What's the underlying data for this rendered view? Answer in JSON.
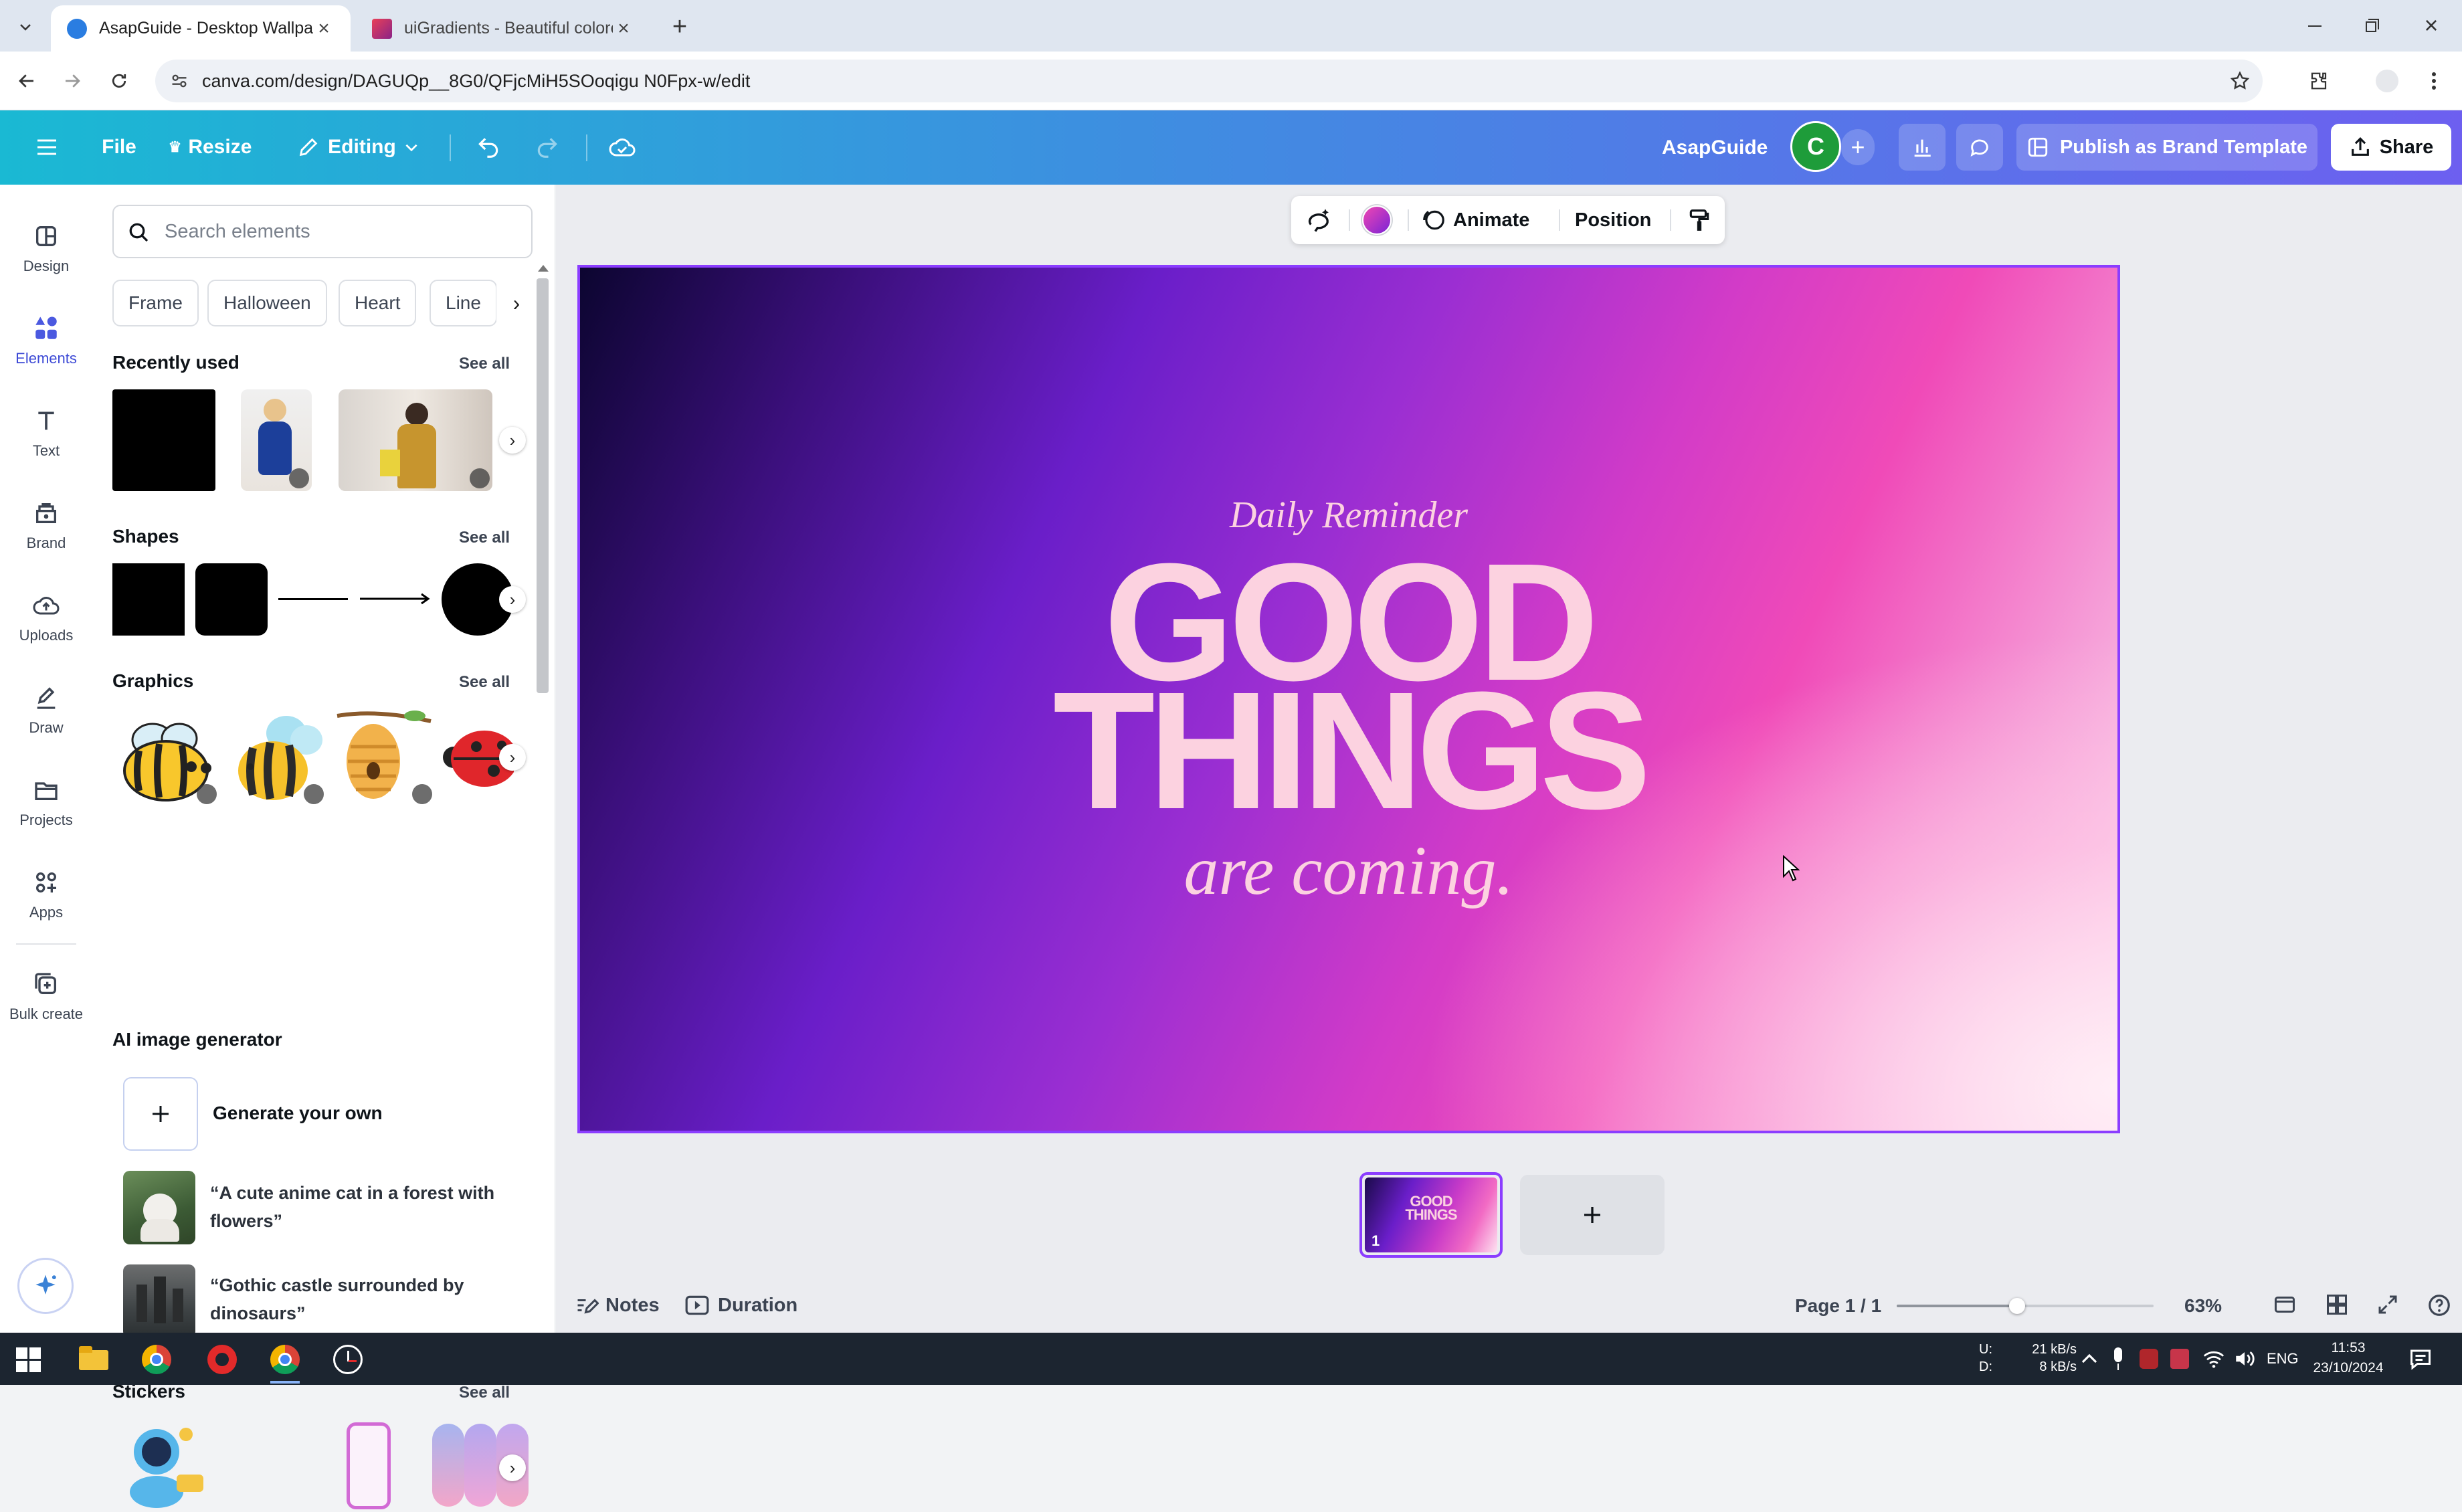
{
  "browser": {
    "tabs": [
      {
        "title": "AsapGuide - Desktop Wallpape",
        "active": true
      },
      {
        "title": "uiGradients - Beautiful colored",
        "active": false
      }
    ],
    "url": "canva.com/design/DAGUQp__8G0/QFjcMiH5SOoqigu N0Fpx-w/edit"
  },
  "topbar": {
    "file_label": "File",
    "resize_label": "Resize",
    "editing_label": "Editing",
    "team_name": "AsapGuide",
    "avatar_letter": "C",
    "publish_label": "Publish as Brand Template",
    "share_label": "Share"
  },
  "rail": [
    {
      "label": "Design",
      "icon": "design-icon"
    },
    {
      "label": "Elements",
      "icon": "elements-icon",
      "active": true
    },
    {
      "label": "Text",
      "icon": "text-icon"
    },
    {
      "label": "Brand",
      "icon": "brand-icon"
    },
    {
      "label": "Uploads",
      "icon": "uploads-icon"
    },
    {
      "label": "Draw",
      "icon": "draw-icon"
    },
    {
      "label": "Projects",
      "icon": "projects-icon"
    },
    {
      "label": "Apps",
      "icon": "apps-icon"
    },
    {
      "label": "Bulk create",
      "icon": "bulk-create-icon"
    }
  ],
  "panel": {
    "search_placeholder": "Search elements",
    "chips": [
      "Frame",
      "Halloween",
      "Heart",
      "Line"
    ],
    "recently_used_title": "Recently used",
    "shapes_title": "Shapes",
    "graphics_title": "Graphics",
    "ai_title": "AI image generator",
    "stickers_title": "Stickers",
    "see_all": "See all",
    "generate_label": "Generate your own",
    "prompt1": "“A cute anime cat in a forest with flowers”",
    "prompt2": "“Gothic castle surrounded by dinosaurs”"
  },
  "toolbar": {
    "animate_label": "Animate",
    "position_label": "Position"
  },
  "design": {
    "subtitle": "Daily Reminder",
    "line1": "GOOD",
    "line2": "THINGS",
    "tagline": "are coming."
  },
  "pages": {
    "thumb_line1": "GOOD",
    "thumb_line2": "THINGS",
    "page_number": "1"
  },
  "bottombar": {
    "notes_label": "Notes",
    "duration_label": "Duration",
    "page_indicator": "Page 1 / 1",
    "zoom": "63%",
    "zoom_fraction": 0.47
  },
  "taskbar": {
    "net_up": "21 kB/s",
    "net_down": "8 kB/s",
    "net_up_label": "U:",
    "net_down_label": "D:",
    "lang": "ENG",
    "time": "11:53",
    "date": "23/10/2024"
  }
}
